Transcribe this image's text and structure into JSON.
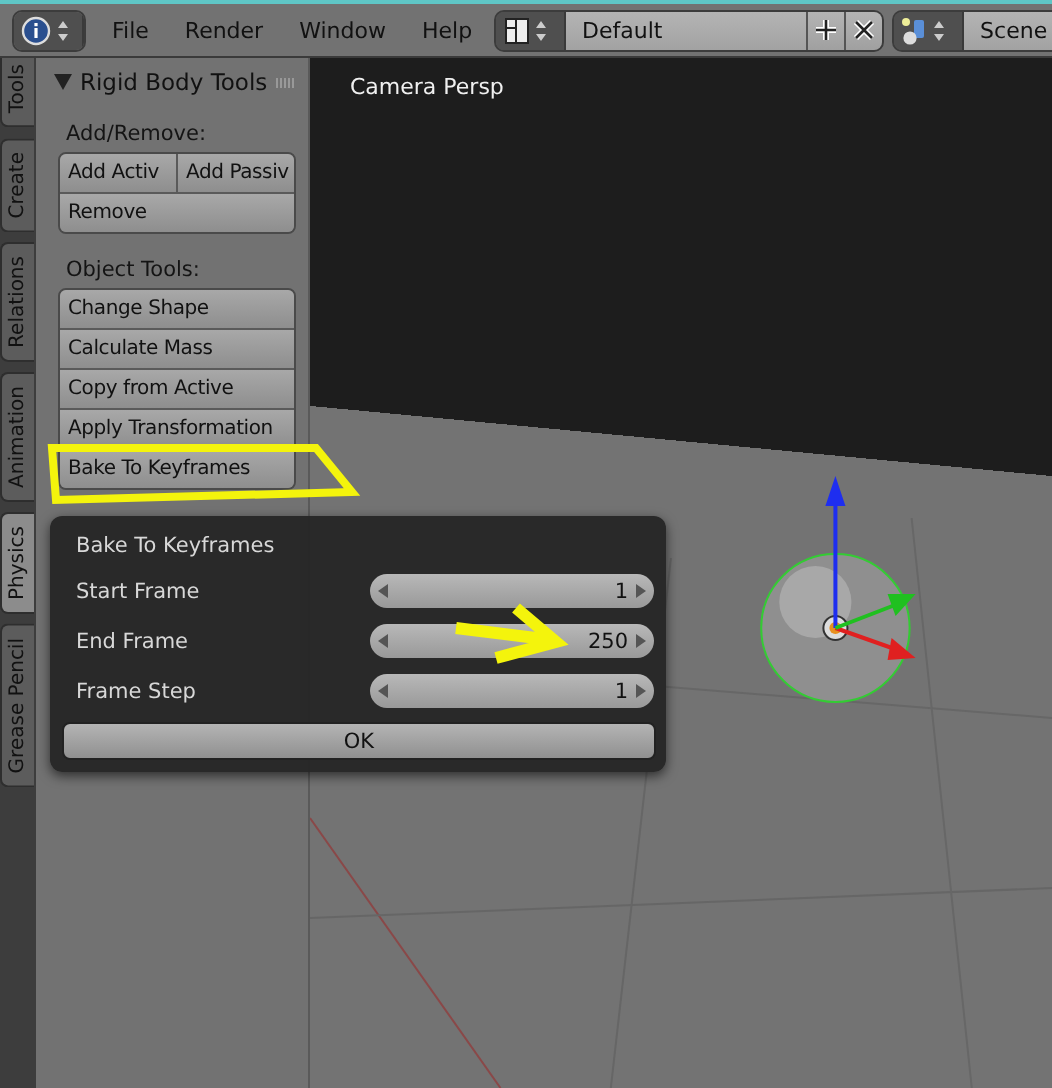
{
  "header": {
    "menus": [
      "File",
      "Render",
      "Window",
      "Help"
    ],
    "layout": "Default",
    "scene": "Scene"
  },
  "tabs": [
    {
      "label": "Tools",
      "selected": false
    },
    {
      "label": "Create",
      "selected": false
    },
    {
      "label": "Relations",
      "selected": false
    },
    {
      "label": "Animation",
      "selected": false
    },
    {
      "label": "Physics",
      "selected": true
    },
    {
      "label": "Grease Pencil",
      "selected": false
    }
  ],
  "panel": {
    "title": "Rigid Body Tools",
    "expanded": true,
    "sections": [
      {
        "label": "Add/Remove:",
        "rows": [
          [
            "Add Activ",
            "Add Passiv"
          ],
          [
            "Remove"
          ]
        ]
      },
      {
        "label": "Object Tools:",
        "rows": [
          [
            "Change Shape"
          ],
          [
            "Calculate Mass"
          ],
          [
            "Copy from Active"
          ],
          [
            "Apply Transformation"
          ],
          [
            "Bake To Keyframes"
          ]
        ]
      }
    ]
  },
  "viewport": {
    "label": "Camera Persp"
  },
  "dialog": {
    "title": "Bake To Keyframes",
    "fields": [
      {
        "label": "Start Frame",
        "value": "1"
      },
      {
        "label": "End Frame",
        "value": "250"
      },
      {
        "label": "Frame Step",
        "value": "1"
      }
    ],
    "ok": "OK"
  }
}
